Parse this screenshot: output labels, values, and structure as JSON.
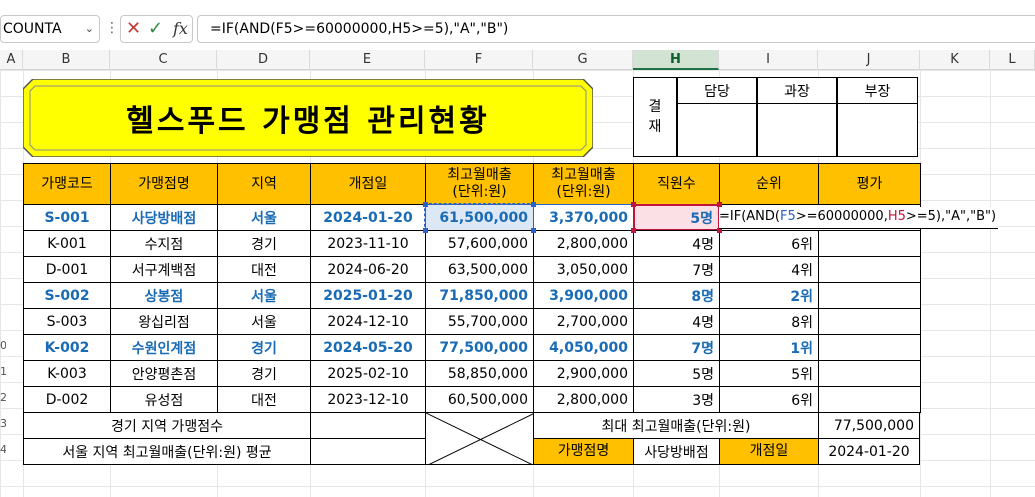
{
  "formula_bar": {
    "name_box": "COUNTA",
    "formula": "=IF(AND(F5>=60000000,H5>=5),\"A\",\"B\")"
  },
  "columns": [
    "A",
    "B",
    "C",
    "D",
    "E",
    "F",
    "G",
    "H",
    "I",
    "J",
    "K",
    "L"
  ],
  "row_numbers": [
    "0",
    "1",
    "2",
    "3",
    "4"
  ],
  "title": "헬스푸드 가맹점 관리현황",
  "approval": {
    "side_label": "결\n재",
    "headers": [
      "담당",
      "과장",
      "부장"
    ]
  },
  "table": {
    "headers": [
      "가맹코드",
      "가맹점명",
      "지역",
      "개점일",
      "최고월매출\n(단위:원)",
      "최고월매출\n(단위:원)",
      "직원수",
      "순위",
      "평가"
    ],
    "rows": [
      {
        "code": "S-001",
        "name": "사당방배점",
        "region": "서울",
        "open": "2024-01-20",
        "max_sales": "61,500,000",
        "sales2": "3,370,000",
        "staff": "5명",
        "rank": "",
        "highlight": true
      },
      {
        "code": "K-001",
        "name": "수지점",
        "region": "경기",
        "open": "2023-11-10",
        "max_sales": "57,600,000",
        "sales2": "2,800,000",
        "staff": "4명",
        "rank": "6위",
        "highlight": false
      },
      {
        "code": "D-001",
        "name": "서구계백점",
        "region": "대전",
        "open": "2024-06-20",
        "max_sales": "63,500,000",
        "sales2": "3,050,000",
        "staff": "7명",
        "rank": "4위",
        "highlight": false
      },
      {
        "code": "S-002",
        "name": "상봉점",
        "region": "서울",
        "open": "2025-01-20",
        "max_sales": "71,850,000",
        "sales2": "3,900,000",
        "staff": "8명",
        "rank": "2위",
        "highlight": true
      },
      {
        "code": "S-003",
        "name": "왕십리점",
        "region": "서울",
        "open": "2024-12-10",
        "max_sales": "55,700,000",
        "sales2": "2,700,000",
        "staff": "4명",
        "rank": "8위",
        "highlight": false
      },
      {
        "code": "K-002",
        "name": "수원인계점",
        "region": "경기",
        "open": "2024-05-20",
        "max_sales": "77,500,000",
        "sales2": "4,050,000",
        "staff": "7명",
        "rank": "1위",
        "highlight": true
      },
      {
        "code": "K-003",
        "name": "안양평촌점",
        "region": "경기",
        "open": "2025-02-10",
        "max_sales": "58,850,000",
        "sales2": "2,900,000",
        "staff": "5명",
        "rank": "5위",
        "highlight": false
      },
      {
        "code": "D-002",
        "name": "유성점",
        "region": "대전",
        "open": "2023-12-10",
        "max_sales": "60,500,000",
        "sales2": "2,800,000",
        "staff": "3명",
        "rank": "6위",
        "highlight": false
      }
    ]
  },
  "editing_formula": {
    "prefix": "=IF(AND(",
    "ref1": "F5",
    "mid": ">=60000000,",
    "ref2": "H5",
    "suffix": ">=5),\"A\",\"B\")"
  },
  "summary": {
    "gyeonggi_count_label": "경기 지역 가맹점수",
    "seoul_avg_label": "서울 지역 최고월매출(단위:원) 평균",
    "max_sales_label": "최대 최고월매출(단위:원)",
    "max_sales_value": "77,500,000",
    "lookup_name_label": "가맹점명",
    "lookup_name_value": "사당방배점",
    "lookup_open_label": "개점일",
    "lookup_open_value": "2024-01-20"
  },
  "colors": {
    "header_fill": "#ffc000",
    "title_fill": "#ffff00",
    "highlight_text": "#1a6bb5",
    "ref_blue": "#2a62c9",
    "ref_red": "#c0143c"
  }
}
